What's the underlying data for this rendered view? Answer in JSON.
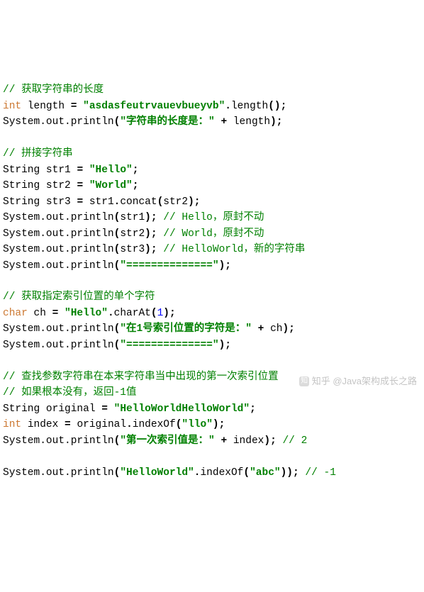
{
  "lines": {
    "c1": "// 获取字符串的长度",
    "l2_kw": "int",
    "l2_id": "length",
    "l2_str": "\"asdasfeutrvauevbueyvb\"",
    "l2_m": "length",
    "l3_pre": "System.out.println",
    "l3_str": "\"字符串的长度是：\"",
    "l3_id": "length",
    "c2": "// 拼接字符串",
    "l6_t": "String",
    "l6_id": "str1",
    "l6_str": "\"Hello\"",
    "l7_t": "String",
    "l7_id": "str2",
    "l7_str": "\"World\"",
    "l8_t": "String",
    "l8_id": "str3",
    "l8_r1": "str1",
    "l8_m": "concat",
    "l8_r2": "str2",
    "l9_pre": "System.out.println",
    "l9_arg": "str1",
    "l9_c": "// Hello，原封不动",
    "l10_pre": "System.out.println",
    "l10_arg": "str2",
    "l10_c": "// World，原封不动",
    "l11_pre": "System.out.println",
    "l11_arg": "str3",
    "l11_c": "// HelloWorld，新的字符串",
    "l12_pre": "System.out.println",
    "l12_str": "\"==============\"",
    "c3": "// 获取指定索引位置的单个字符",
    "l15_kw": "char",
    "l15_id": "ch",
    "l15_str": "\"Hello\"",
    "l15_m": "charAt",
    "l15_n": "1",
    "l16_pre": "System.out.println",
    "l16_str": "\"在1号索引位置的字符是：\"",
    "l16_id": "ch",
    "l17_pre": "System.out.println",
    "l17_str": "\"==============\"",
    "c4a": "// 查找参数字符串在本来字符串当中出现的第一次索引位置",
    "c4b": "// 如果根本没有，返回-1值",
    "l21_t": "String",
    "l21_id": "original",
    "l21_str": "\"HelloWorldHelloWorld\"",
    "l22_kw": "int",
    "l22_id": "index",
    "l22_r": "original",
    "l22_m": "indexOf",
    "l22_str": "\"llo\"",
    "l23_pre": "System.out.println",
    "l23_str": "\"第一次索引值是：\"",
    "l23_id": "index",
    "l23_c": "// 2",
    "l25_pre": "System.out.println",
    "l25_str1": "\"HelloWorld\"",
    "l25_m": "indexOf",
    "l25_str2": "\"abc\"",
    "l25_c": "// -1"
  },
  "watermark": {
    "icon": "知",
    "text": "知乎 @Java架构成长之路"
  }
}
